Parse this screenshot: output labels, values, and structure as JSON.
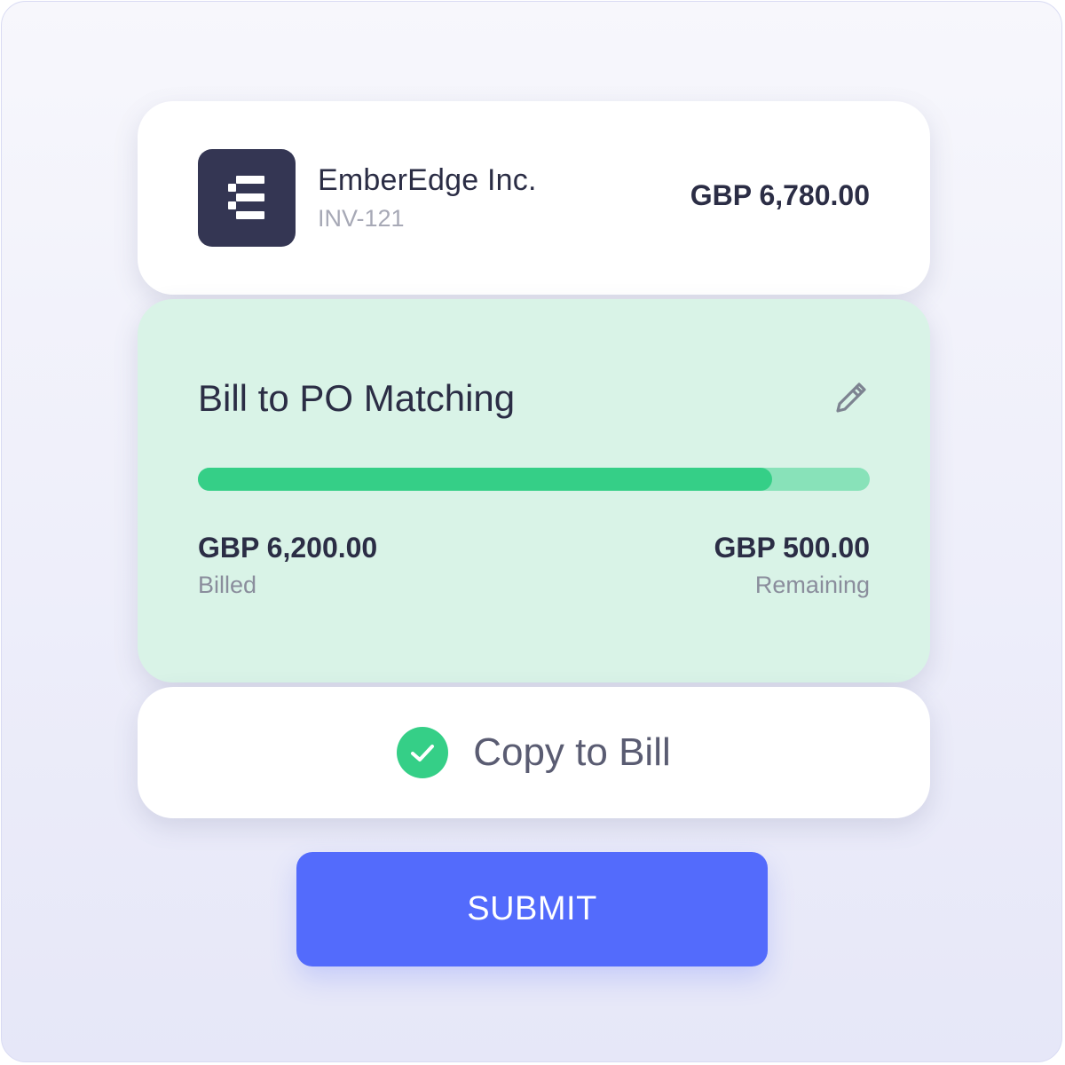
{
  "vendor": {
    "name": "EmberEdge Inc.",
    "invoice_id": "INV-121",
    "amount": "GBP 6,780.00",
    "logo_icon": "emberedge-logo-icon"
  },
  "matching": {
    "title": "Bill to PO Matching",
    "edit_icon": "pencil-icon",
    "progress_fraction": 0.855,
    "billed": {
      "value": "GBP 6,200.00",
      "label": "Billed"
    },
    "remaining": {
      "value": "GBP 500.00",
      "label": "Remaining"
    }
  },
  "copy_to_bill": {
    "label": "Copy to Bill",
    "checked": true,
    "icon": "check-circle-icon"
  },
  "submit": {
    "label": "SUBMIT"
  },
  "colors": {
    "accent_blue": "#536bfc",
    "success_green": "#35cf87",
    "progress_track": "#88e2b9",
    "match_card_bg": "#d9f3e7",
    "logo_bg": "#343653",
    "text_dark": "#2b2d45"
  }
}
